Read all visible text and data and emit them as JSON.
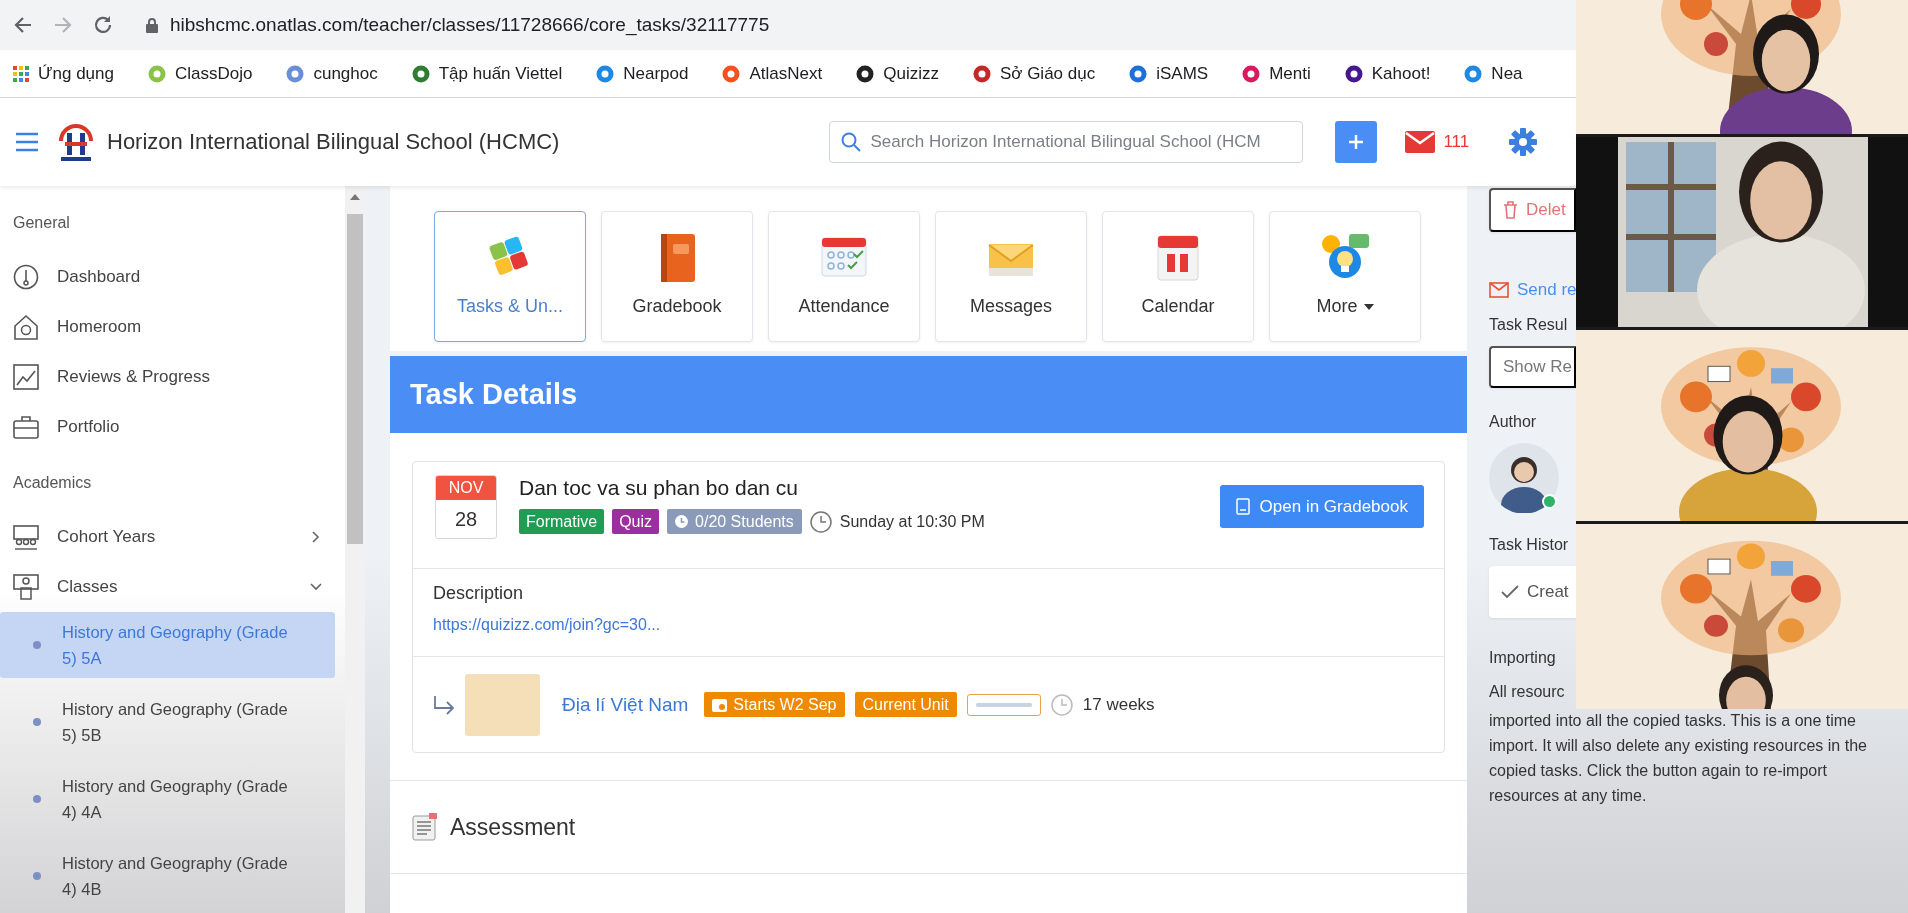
{
  "browser": {
    "url": "hibshcmc.onatlas.com/teacher/classes/11728666/core_tasks/32117775",
    "bookmarks": [
      "Ứng dụng",
      "ClassDojo",
      "cunghoc",
      "Tập huấn Viettel",
      "Nearpod",
      "AtlasNext",
      "Quizizz",
      "Sở Giáo dục",
      "iSAMS",
      "Menti",
      "Kahoot!",
      "Nea"
    ]
  },
  "header": {
    "school": "Horizon International Bilingual School (HCMC)",
    "search_placeholder": "Search Horizon International Bilingual School (HCM",
    "mail_count": "111"
  },
  "sidebar": {
    "sections": [
      {
        "title": "General",
        "items": [
          {
            "label": "Dashboard"
          },
          {
            "label": "Homeroom"
          },
          {
            "label": "Reviews & Progress"
          },
          {
            "label": "Portfolio"
          }
        ]
      },
      {
        "title": "Academics",
        "items": [
          {
            "label": "Cohort Years",
            "expanded": false
          },
          {
            "label": "Classes",
            "expanded": true,
            "children": [
              {
                "label": "History and Geography (Grade 5) 5A",
                "selected": true
              },
              {
                "label": "History and Geography (Grade 5) 5B",
                "selected": false
              },
              {
                "label": "History and Geography (Grade 4) 4A",
                "selected": false
              },
              {
                "label": "History and Geography (Grade 4) 4B",
                "selected": false
              }
            ]
          }
        ]
      }
    ]
  },
  "tools": [
    {
      "label": "Tasks & Un...",
      "selected": true,
      "dropdown": false
    },
    {
      "label": "Gradebook",
      "selected": false,
      "dropdown": false
    },
    {
      "label": "Attendance",
      "selected": false,
      "dropdown": false
    },
    {
      "label": "Messages",
      "selected": false,
      "dropdown": false
    },
    {
      "label": "Calendar",
      "selected": false,
      "dropdown": false
    },
    {
      "label": "More",
      "selected": false,
      "dropdown": true
    }
  ],
  "task": {
    "section_title": "Task Details",
    "month": "NOV",
    "day": "28",
    "title": "Dan toc va su phan bo dan cu",
    "tags": [
      {
        "label": "Formative",
        "color": "#1f9d55"
      },
      {
        "label": "Quiz",
        "color": "#9c2f9e"
      }
    ],
    "students": "0/20 Students",
    "due": "Sunday at 10:30 PM",
    "button": "Open in Gradebook",
    "description_label": "Description",
    "link": "https://quizizz.com/join?gc=30...",
    "unit": {
      "name": "Địa lí Việt Nam",
      "start": "Starts W2 Sep",
      "status": "Current Unit",
      "level": 1,
      "duration": "17 weeks"
    },
    "assessment_title": "Assessment"
  },
  "panel": {
    "delete": "Delet",
    "send": "Send re",
    "results_label": "Task Resul",
    "show_results": "Show Re",
    "author_label": "Author",
    "author_online": true,
    "history_label": "Task Histor",
    "history_item": "Creat",
    "importing_label": "Importing",
    "importing_first": "All resourc",
    "importing_text": "imported into all the copied tasks. This is a one time import. It will also delete any existing resources in the copied tasks. Click the button again to re-import resources at any time."
  }
}
